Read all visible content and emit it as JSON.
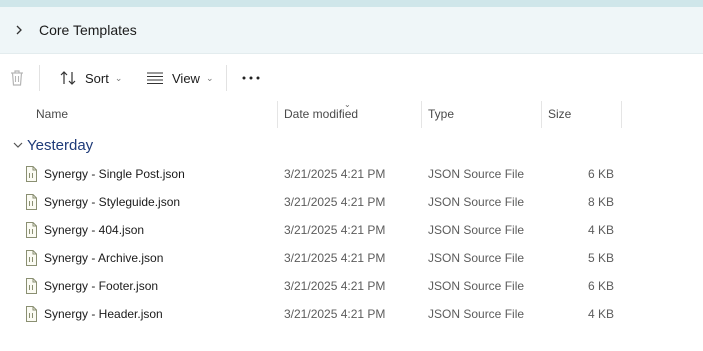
{
  "address": {
    "current_folder": "Core Templates"
  },
  "toolbar": {
    "sort_label": "Sort",
    "view_label": "View",
    "more_label": "···"
  },
  "columns": {
    "name": "Name",
    "date_modified": "Date modified",
    "type": "Type",
    "size": "Size"
  },
  "group": {
    "label": "Yesterday"
  },
  "files": [
    {
      "name": "Synergy - Single Post.json",
      "date": "3/21/2025 4:21 PM",
      "type": "JSON Source File",
      "size": "6 KB"
    },
    {
      "name": "Synergy - Styleguide.json",
      "date": "3/21/2025 4:21 PM",
      "type": "JSON Source File",
      "size": "8 KB"
    },
    {
      "name": "Synergy - 404.json",
      "date": "3/21/2025 4:21 PM",
      "type": "JSON Source File",
      "size": "4 KB"
    },
    {
      "name": "Synergy - Archive.json",
      "date": "3/21/2025 4:21 PM",
      "type": "JSON Source File",
      "size": "5 KB"
    },
    {
      "name": "Synergy - Footer.json",
      "date": "3/21/2025 4:21 PM",
      "type": "JSON Source File",
      "size": "6 KB"
    },
    {
      "name": "Synergy - Header.json",
      "date": "3/21/2025 4:21 PM",
      "type": "JSON Source File",
      "size": "4 KB"
    }
  ],
  "icons": {
    "breadcrumb": "chevron-right-icon",
    "delete": "trash-icon",
    "sort": "sort-arrows-icon",
    "view": "view-lines-icon",
    "more": "more-dots-icon",
    "group": "chevron-down-icon",
    "file": "json-file-icon"
  }
}
